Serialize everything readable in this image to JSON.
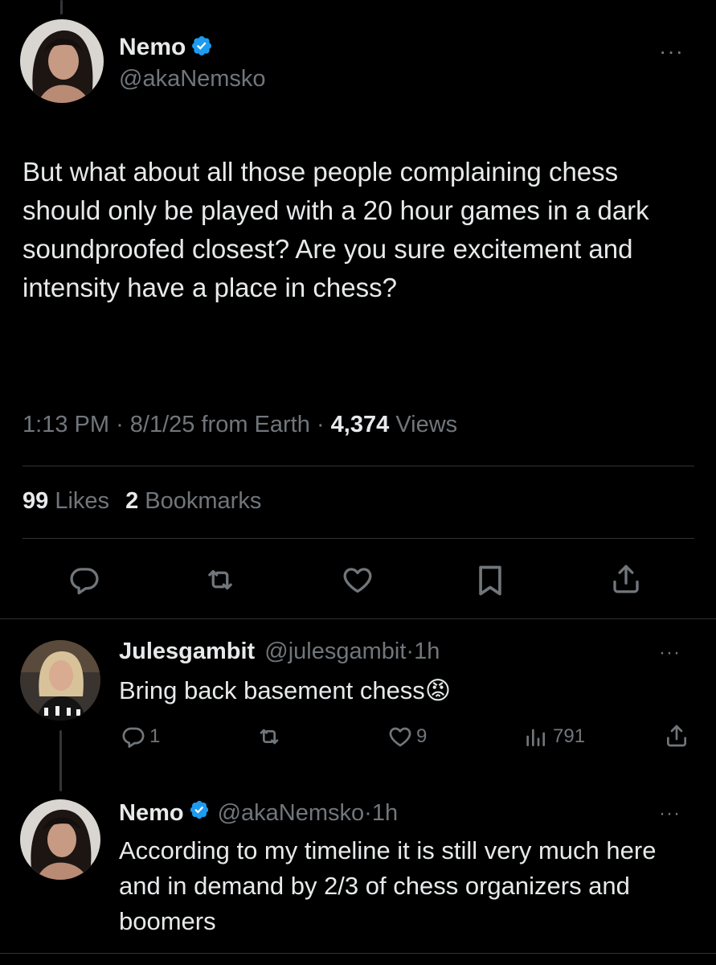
{
  "main_tweet": {
    "name": "Nemo",
    "handle": "@akaNemsko",
    "text": "But what about all those people complaining chess should only be played with a 20 hour games in a dark soundproofed closest? Are you sure excitement and intensity have a place in chess?",
    "time": "1:13 PM",
    "date": "8/1/25",
    "source": "from Earth",
    "views_count": "4,374",
    "views_label": "Views",
    "likes_count": "99",
    "likes_label": "Likes",
    "bookmarks_count": "2",
    "bookmarks_label": "Bookmarks",
    "separator": "·",
    "more": "···"
  },
  "replies": [
    {
      "name": "Julesgambit",
      "handle": "@julesgambit",
      "time": "1h",
      "text": "Bring back basement chess",
      "emoji": "😡",
      "reply_count": "1",
      "like_count": "9",
      "view_count": "791"
    },
    {
      "name": "Nemo",
      "handle": "@akaNemsko",
      "time": "1h",
      "text": "According to my timeline it is still very much here and in demand by 2/3 of chess organizers and boomers"
    }
  ],
  "icons": {
    "verified": "verified-badge-icon",
    "reply": "reply-icon",
    "retweet": "retweet-icon",
    "like": "heart-icon",
    "bookmark": "bookmark-icon",
    "share": "share-icon",
    "views": "views-bar-icon"
  },
  "colors": {
    "background": "#000000",
    "text": "#e7e9ea",
    "muted": "#71767b",
    "verified": "#1d9bf0",
    "divider": "#2f3336"
  }
}
